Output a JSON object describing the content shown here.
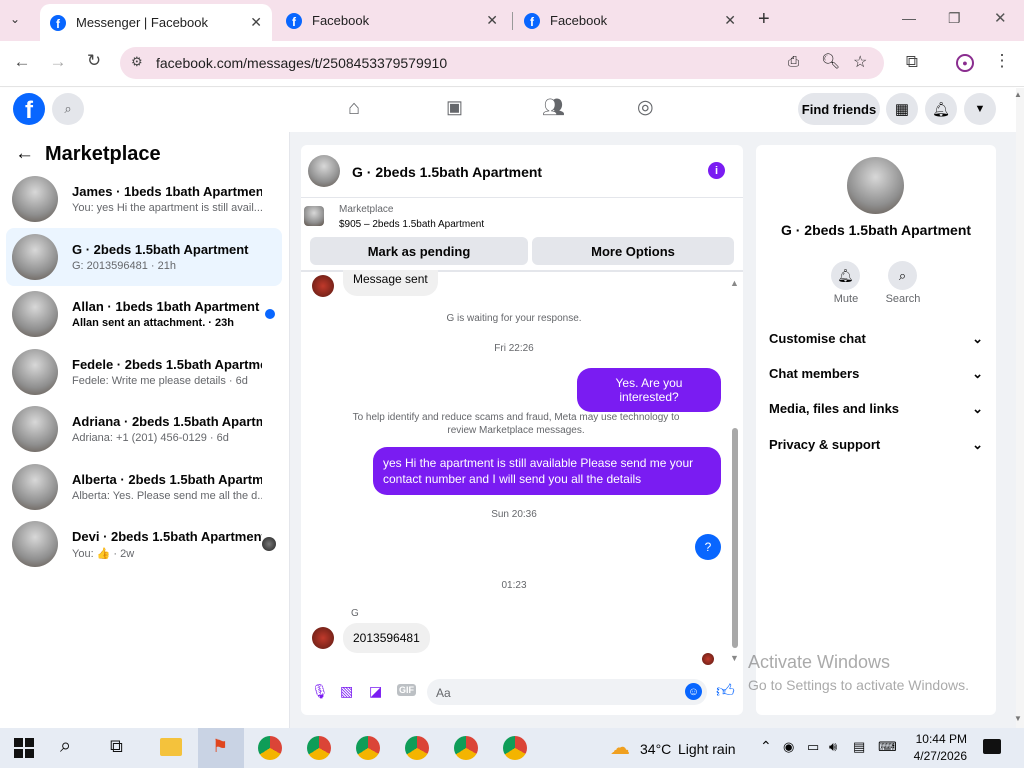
{
  "browser": {
    "tabs": [
      {
        "title": "Messenger | Facebook",
        "active": true
      },
      {
        "title": "Facebook",
        "active": false
      },
      {
        "title": "Facebook",
        "active": false
      }
    ],
    "url": "facebook.com/messages/t/2508453379579910"
  },
  "fb_header": {
    "logo": "f",
    "find_friends": "Find friends"
  },
  "sidebar": {
    "title": "Marketplace",
    "conversations": [
      {
        "name": "James · 1beds 1bath Apartment",
        "preview": "You: yes Hi the apartment is still avail... · 1m",
        "selected": false,
        "bold": false
      },
      {
        "name": "G · 2beds 1.5bath Apartment",
        "preview": "G: 2013596481 · 21h",
        "selected": true,
        "bold": false
      },
      {
        "name": "Allan · 1beds 1bath Apartment",
        "preview": "Allan sent an attachment. · 23h",
        "selected": false,
        "bold": true
      },
      {
        "name": "Fedele · 2beds 1.5bath Apartment",
        "preview": "Fedele: Write me please details · 6d",
        "selected": false,
        "bold": false
      },
      {
        "name": "Adriana · 2beds 1.5bath Apartment",
        "preview": "Adriana: +1 (201) 456-0129 · 6d",
        "selected": false,
        "bold": false
      },
      {
        "name": "Alberta · 2beds 1.5bath Apartment",
        "preview": "Alberta: Yes. Please send me all the d... · 2w",
        "selected": false,
        "bold": false
      },
      {
        "name": "Devi · 2beds 1.5bath Apartment",
        "preview": "You: 👍 · 2w",
        "selected": false,
        "bold": false
      }
    ]
  },
  "chat": {
    "title": "G · 2beds 1.5bath Apartment",
    "listing_source": "Marketplace",
    "listing_detail": "$905 – 2beds 1.5bath Apartment",
    "mark_pending": "Mark as pending",
    "more_options": "More Options",
    "message_sent": "Message sent",
    "waiting": "G is waiting for your response.",
    "time1": "Fri 22:26",
    "msg_interested": "Yes. Are you interested?",
    "scam_notice": "To help identify and reduce scams and fraud, Meta may use technology to review Marketplace messages.",
    "msg_available": "yes Hi the apartment is still available Please send me your contact number and I will send you all the details",
    "time2": "Sun 20:36",
    "msg_question": "?",
    "time3": "01:23",
    "sender_g": "G",
    "msg_number": "2013596481",
    "input_placeholder": "Aa"
  },
  "right_panel": {
    "title": "G · 2beds 1.5bath Apartment",
    "mute": "Mute",
    "search": "Search",
    "sections": [
      "Customise chat",
      "Chat members",
      "Media, files and links",
      "Privacy & support"
    ]
  },
  "watermark": {
    "line1": "Activate Windows",
    "line2": "Go to Settings to activate Windows."
  },
  "taskbar": {
    "weather_temp": "34°C",
    "weather_desc": "Light rain",
    "time": "10:44 PM",
    "date": "4/27/2026"
  },
  "colors": {
    "fb_blue": "#0866ff",
    "bubble_purple": "#7a1cf2",
    "selected_bg": "#ebf5ff"
  }
}
